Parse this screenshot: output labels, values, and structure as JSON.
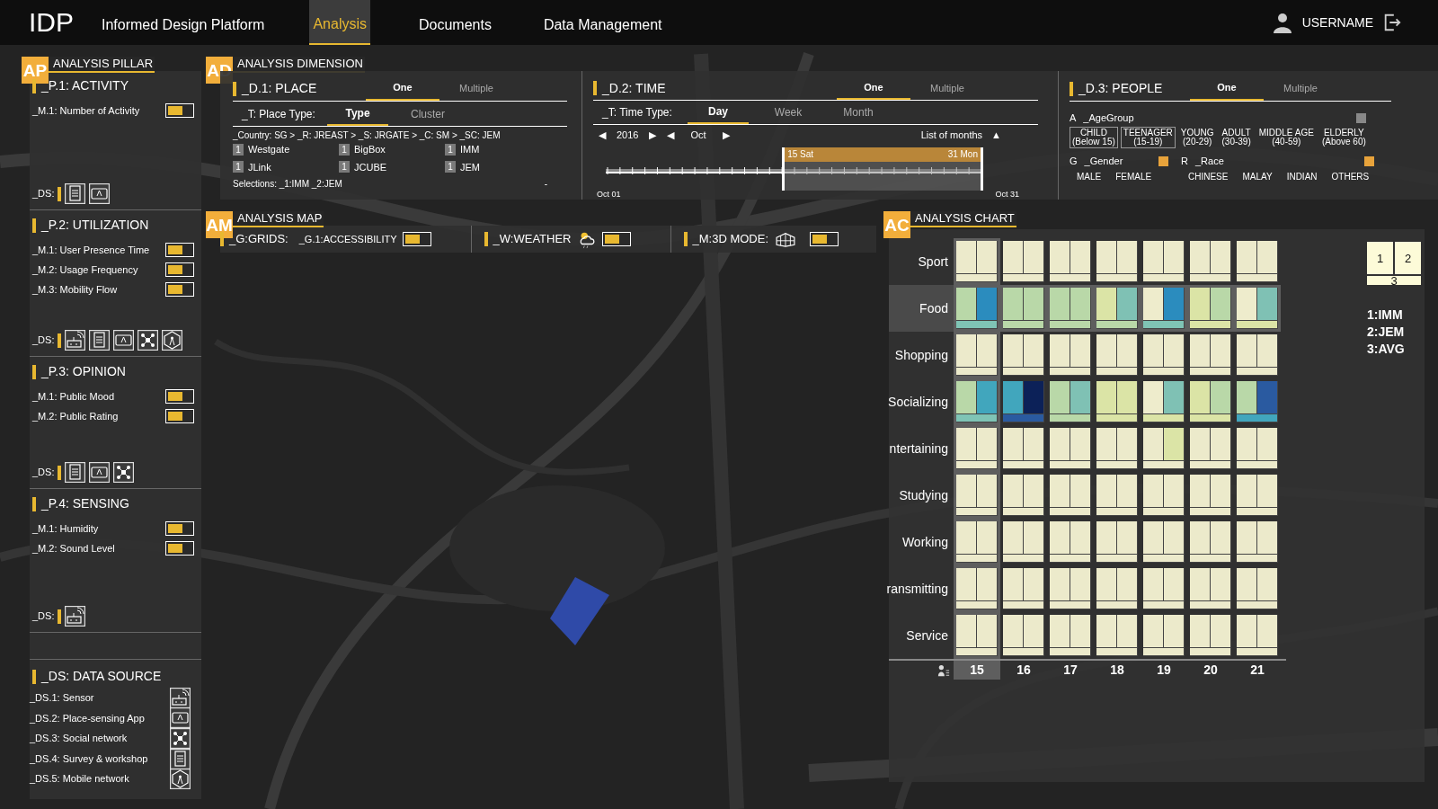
{
  "nav": {
    "logo": "IDP",
    "title": "Informed Design Platform",
    "user": "USERNAME",
    "tabs": [
      {
        "label": "Analysis",
        "selected": true
      },
      {
        "label": "Documents",
        "selected": false
      },
      {
        "label": "Data Management",
        "selected": false
      }
    ]
  },
  "pillar": {
    "badge": "AP",
    "title": "ANALYSIS PILLAR",
    "sections": [
      {
        "title": "_P.1: ACTIVITY",
        "metrics": [
          {
            "label": "_M.1: Number of Activity",
            "on": true
          }
        ],
        "ds_label": "_DS:",
        "sources": [
          {
            "kind": "survey"
          },
          {
            "kind": "app"
          }
        ]
      },
      {
        "title": "_P.2: UTILIZATION",
        "metrics": [
          {
            "label": "_M.1: User Presence Time",
            "on": true
          },
          {
            "label": "_M.2: Usage Frequency",
            "on": true
          },
          {
            "label": "_M.3: Mobility Flow",
            "on": true
          }
        ],
        "ds_label": "_DS:",
        "sources": [
          {
            "kind": "sensor"
          },
          {
            "kind": "survey"
          },
          {
            "kind": "app"
          },
          {
            "kind": "social"
          },
          {
            "kind": "mobile"
          }
        ]
      },
      {
        "title": "_P.3: OPINION",
        "metrics": [
          {
            "label": "_M.1: Public Mood",
            "on": true
          },
          {
            "label": "_M.2: Public Rating",
            "on": true
          }
        ],
        "ds_label": "_DS:",
        "sources": [
          {
            "kind": "survey"
          },
          {
            "kind": "app"
          },
          {
            "kind": "social"
          }
        ]
      },
      {
        "title": "_P.4: SENSING",
        "metrics": [
          {
            "label": "_M.1: Humidity",
            "on": true
          },
          {
            "label": "_M.2: Sound Level",
            "on": true
          }
        ],
        "ds_label": "_DS:",
        "sources": [
          {
            "kind": "sensor"
          }
        ]
      }
    ],
    "data_source": {
      "title": "_DS: DATA SOURCE",
      "items": [
        {
          "label": "_DS.1: Sensor",
          "kind": "sensor"
        },
        {
          "label": "_DS.2: Place-sensing App",
          "kind": "app"
        },
        {
          "label": "_DS.3: Social network",
          "kind": "social"
        },
        {
          "label": "_DS.4: Survey & workshop",
          "kind": "survey"
        },
        {
          "label": "_DS.5: Mobile network",
          "kind": "mobile"
        }
      ]
    }
  },
  "dimension": {
    "badge": "AD",
    "title": "ANALYSIS DIMENSION",
    "place": {
      "title": "_D.1: PLACE",
      "modes": [
        {
          "label": "One",
          "selected": true
        },
        {
          "label": "Multiple",
          "selected": false
        }
      ],
      "type_label": "_T: Place Type:",
      "types": [
        {
          "label": "Type",
          "selected": true
        },
        {
          "label": "Cluster",
          "selected": false
        }
      ],
      "breadcrumb": "_Country: SG > _R: JREAST > _S: JRGATE > _C: SM > _SC: JEM",
      "places": [
        {
          "count": "1",
          "name": "Westgate"
        },
        {
          "count": "1",
          "name": "BigBox"
        },
        {
          "count": "1",
          "name": "IMM"
        },
        {
          "count": "1",
          "name": "JLink"
        },
        {
          "count": "1",
          "name": "JCUBE"
        },
        {
          "count": "1",
          "name": "JEM"
        }
      ],
      "selections": "Selections: _1:IMM _2:JEM",
      "collapse": "-"
    },
    "time": {
      "title": "_D.2: TIME",
      "modes": [
        {
          "label": "One",
          "selected": true
        },
        {
          "label": "Multiple",
          "selected": false
        }
      ],
      "type_label": "_T: Time Type:",
      "types": [
        {
          "label": "Day",
          "selected": true
        },
        {
          "label": "Week",
          "selected": false
        },
        {
          "label": "Month",
          "selected": false
        }
      ],
      "year_prev": "◀",
      "year": "2016",
      "year_next": "▶",
      "month_prev": "◀",
      "month": "Oct",
      "month_next": "▶",
      "months_list": "List of months",
      "months_toggle": "▲",
      "start": "Oct 01",
      "end": "Oct 31",
      "range": {
        "from_label": "15 Sat",
        "to_label": "31 Mon",
        "handles": [
          {
            "level": 0.467
          },
          {
            "level": 1
          }
        ]
      }
    },
    "people": {
      "title": "_D.3: PEOPLE",
      "modes": [
        {
          "label": "One",
          "selected": true
        },
        {
          "label": "Multiple",
          "selected": false
        }
      ],
      "age": {
        "key": "A",
        "label": "_AgeGroup",
        "on": false,
        "groups": [
          {
            "name": "CHILD",
            "range": "(Below 15)",
            "selected": true
          },
          {
            "name": "TEENAGER",
            "range": "(15-19)",
            "selected": true
          },
          {
            "name": "YOUNG",
            "range": "(20-29)",
            "selected": false
          },
          {
            "name": "ADULT",
            "range": "(30-39)",
            "selected": false
          },
          {
            "name": "MIDDLE AGE",
            "range": "(40-59)",
            "selected": false
          },
          {
            "name": "ELDERLY",
            "range": "(Above 60)",
            "selected": false
          }
        ]
      },
      "gender": {
        "key": "G",
        "label": "_Gender",
        "on": true,
        "options": [
          "MALE",
          "FEMALE"
        ]
      },
      "race": {
        "key": "R",
        "label": "_Race",
        "on": true,
        "options": [
          "CHINESE",
          "MALAY",
          "INDIAN",
          "OTHERS"
        ]
      }
    }
  },
  "map": {
    "badge": "AM",
    "title": "ANALYSIS MAP",
    "grids_label": "_G:GRIDS:",
    "grids": [
      {
        "label": "_G.1:ACCESSIBILITY",
        "on": true
      }
    ],
    "weather": {
      "label": "_W:WEATHER",
      "on": true
    },
    "mode3d": {
      "label": "_M:3D MODE:",
      "on": true
    }
  },
  "chart": {
    "badge": "AC",
    "title": "ANALYSIS CHART",
    "columns": [
      {
        "label": "15",
        "selected": true
      },
      {
        "label": "16",
        "selected": false
      },
      {
        "label": "17",
        "selected": false
      },
      {
        "label": "18",
        "selected": false
      },
      {
        "label": "19",
        "selected": false
      },
      {
        "label": "20",
        "selected": false
      },
      {
        "label": "21",
        "selected": false
      }
    ],
    "rows": [
      {
        "label": "Sport",
        "selected": false,
        "cells": [
          {
            "segments": [
              {
                "color": "#eceacb"
              },
              {
                "color": "#eceacb"
              },
              {
                "color": "#eceacb"
              }
            ]
          },
          {
            "segments": [
              {
                "color": "#eceacb"
              },
              {
                "color": "#eceacb"
              },
              {
                "color": "#eceacb"
              }
            ]
          },
          {
            "segments": [
              {
                "color": "#eceacb"
              },
              {
                "color": "#eceacb"
              },
              {
                "color": "#eceacb"
              }
            ]
          },
          {
            "segments": [
              {
                "color": "#eceacb"
              },
              {
                "color": "#eceacb"
              },
              {
                "color": "#eceacb"
              }
            ]
          },
          {
            "segments": [
              {
                "color": "#eceacb"
              },
              {
                "color": "#eceacb"
              },
              {
                "color": "#eceacb"
              }
            ]
          },
          {
            "segments": [
              {
                "color": "#eceacb"
              },
              {
                "color": "#eceacb"
              },
              {
                "color": "#eceacb"
              }
            ]
          },
          {
            "segments": [
              {
                "color": "#eceacb"
              },
              {
                "color": "#eceacb"
              },
              {
                "color": "#eceacb"
              }
            ]
          }
        ]
      },
      {
        "label": "Food",
        "selected": true,
        "cells": [
          {
            "segments": [
              {
                "color": "#b9d8a8"
              },
              {
                "color": "#2b8cbe"
              },
              {
                "color": "#7fc4b5"
              }
            ]
          },
          {
            "segments": [
              {
                "color": "#b9d8a8"
              },
              {
                "color": "#b9d8a8"
              },
              {
                "color": "#b9d8a8"
              }
            ]
          },
          {
            "segments": [
              {
                "color": "#b9d8a8"
              },
              {
                "color": "#b9d8a8"
              },
              {
                "color": "#b9d8a8"
              }
            ]
          },
          {
            "segments": [
              {
                "color": "#dbe4a6"
              },
              {
                "color": "#7fc1b4"
              },
              {
                "color": "#b9d8a8"
              }
            ]
          },
          {
            "segments": [
              {
                "color": "#eeeccc"
              },
              {
                "color": "#2b8cbe"
              },
              {
                "color": "#7fc4b5"
              }
            ]
          },
          {
            "segments": [
              {
                "color": "#dbe4a6"
              },
              {
                "color": "#b9d8a8"
              },
              {
                "color": "#dbe4a6"
              }
            ]
          },
          {
            "segments": [
              {
                "color": "#eeeccc"
              },
              {
                "color": "#7fc1b4"
              },
              {
                "color": "#dbe4a6"
              }
            ]
          }
        ]
      },
      {
        "label": "Shopping",
        "selected": false,
        "cells": [
          {
            "segments": [
              {
                "color": "#eceacb"
              },
              {
                "color": "#eceacb"
              },
              {
                "color": "#eceacb"
              }
            ]
          },
          {
            "segments": [
              {
                "color": "#eceacb"
              },
              {
                "color": "#eceacb"
              },
              {
                "color": "#eceacb"
              }
            ]
          },
          {
            "segments": [
              {
                "color": "#eceacb"
              },
              {
                "color": "#eceacb"
              },
              {
                "color": "#eceacb"
              }
            ]
          },
          {
            "segments": [
              {
                "color": "#eceacb"
              },
              {
                "color": "#eceacb"
              },
              {
                "color": "#eceacb"
              }
            ]
          },
          {
            "segments": [
              {
                "color": "#eceacb"
              },
              {
                "color": "#eceacb"
              },
              {
                "color": "#eceacb"
              }
            ]
          },
          {
            "segments": [
              {
                "color": "#eceacb"
              },
              {
                "color": "#eceacb"
              },
              {
                "color": "#eceacb"
              }
            ]
          },
          {
            "segments": [
              {
                "color": "#eceacb"
              },
              {
                "color": "#eceacb"
              },
              {
                "color": "#eceacb"
              }
            ]
          }
        ]
      },
      {
        "label": "Socializing",
        "selected": false,
        "cells": [
          {
            "segments": [
              {
                "color": "#b9d8a8"
              },
              {
                "color": "#41a6bd"
              },
              {
                "color": "#7fc4b5"
              }
            ]
          },
          {
            "segments": [
              {
                "color": "#41a6bd"
              },
              {
                "color": "#0c2158"
              },
              {
                "color": "#2a5aa0"
              }
            ]
          },
          {
            "segments": [
              {
                "color": "#b9d8a8"
              },
              {
                "color": "#7fc1b4"
              },
              {
                "color": "#b9d8a8"
              }
            ]
          },
          {
            "segments": [
              {
                "color": "#dbe4a6"
              },
              {
                "color": "#dbe4a6"
              },
              {
                "color": "#dbe4a6"
              }
            ]
          },
          {
            "segments": [
              {
                "color": "#eeeccc"
              },
              {
                "color": "#7fc1b4"
              },
              {
                "color": "#dbe4a6"
              }
            ]
          },
          {
            "segments": [
              {
                "color": "#dbe4a6"
              },
              {
                "color": "#b9d8a8"
              },
              {
                "color": "#dbe4a6"
              }
            ]
          },
          {
            "segments": [
              {
                "color": "#b9d8a8"
              },
              {
                "color": "#2a5aa0"
              },
              {
                "color": "#41a6bd"
              }
            ]
          }
        ]
      },
      {
        "label": "ntertaining",
        "selected": false,
        "cells": [
          {
            "segments": [
              {
                "color": "#eceacb"
              },
              {
                "color": "#eceacb"
              },
              {
                "color": "#eceacb"
              }
            ]
          },
          {
            "segments": [
              {
                "color": "#eceacb"
              },
              {
                "color": "#eceacb"
              },
              {
                "color": "#eceacb"
              }
            ]
          },
          {
            "segments": [
              {
                "color": "#eceacb"
              },
              {
                "color": "#eceacb"
              },
              {
                "color": "#eceacb"
              }
            ]
          },
          {
            "segments": [
              {
                "color": "#eceacb"
              },
              {
                "color": "#eceacb"
              },
              {
                "color": "#eceacb"
              }
            ]
          },
          {
            "segments": [
              {
                "color": "#eceacb"
              },
              {
                "color": "#dbe4a6"
              },
              {
                "color": "#eceacb"
              }
            ]
          },
          {
            "segments": [
              {
                "color": "#eceacb"
              },
              {
                "color": "#eceacb"
              },
              {
                "color": "#eceacb"
              }
            ]
          },
          {
            "segments": [
              {
                "color": "#eceacb"
              },
              {
                "color": "#eceacb"
              },
              {
                "color": "#eceacb"
              }
            ]
          }
        ]
      },
      {
        "label": "Studying",
        "selected": false,
        "cells": [
          {
            "segments": [
              {
                "color": "#eceacb"
              },
              {
                "color": "#eceacb"
              },
              {
                "color": "#eceacb"
              }
            ]
          },
          {
            "segments": [
              {
                "color": "#eceacb"
              },
              {
                "color": "#eceacb"
              },
              {
                "color": "#eceacb"
              }
            ]
          },
          {
            "segments": [
              {
                "color": "#eceacb"
              },
              {
                "color": "#eceacb"
              },
              {
                "color": "#eceacb"
              }
            ]
          },
          {
            "segments": [
              {
                "color": "#eceacb"
              },
              {
                "color": "#eceacb"
              },
              {
                "color": "#eceacb"
              }
            ]
          },
          {
            "segments": [
              {
                "color": "#eceacb"
              },
              {
                "color": "#eceacb"
              },
              {
                "color": "#eceacb"
              }
            ]
          },
          {
            "segments": [
              {
                "color": "#eceacb"
              },
              {
                "color": "#eceacb"
              },
              {
                "color": "#eceacb"
              }
            ]
          },
          {
            "segments": [
              {
                "color": "#eceacb"
              },
              {
                "color": "#eceacb"
              },
              {
                "color": "#eceacb"
              }
            ]
          }
        ]
      },
      {
        "label": "Working",
        "selected": false,
        "cells": [
          {
            "segments": [
              {
                "color": "#eceacb"
              },
              {
                "color": "#eceacb"
              },
              {
                "color": "#eceacb"
              }
            ]
          },
          {
            "segments": [
              {
                "color": "#eceacb"
              },
              {
                "color": "#eceacb"
              },
              {
                "color": "#eceacb"
              }
            ]
          },
          {
            "segments": [
              {
                "color": "#eceacb"
              },
              {
                "color": "#eceacb"
              },
              {
                "color": "#eceacb"
              }
            ]
          },
          {
            "segments": [
              {
                "color": "#eceacb"
              },
              {
                "color": "#eceacb"
              },
              {
                "color": "#eceacb"
              }
            ]
          },
          {
            "segments": [
              {
                "color": "#eceacb"
              },
              {
                "color": "#eceacb"
              },
              {
                "color": "#eceacb"
              }
            ]
          },
          {
            "segments": [
              {
                "color": "#eceacb"
              },
              {
                "color": "#eceacb"
              },
              {
                "color": "#eceacb"
              }
            ]
          },
          {
            "segments": [
              {
                "color": "#eceacb"
              },
              {
                "color": "#eceacb"
              },
              {
                "color": "#eceacb"
              }
            ]
          }
        ]
      },
      {
        "label": "ransmitting",
        "selected": false,
        "cells": [
          {
            "segments": [
              {
                "color": "#eceacb"
              },
              {
                "color": "#eceacb"
              },
              {
                "color": "#eceacb"
              }
            ]
          },
          {
            "segments": [
              {
                "color": "#eceacb"
              },
              {
                "color": "#eceacb"
              },
              {
                "color": "#eceacb"
              }
            ]
          },
          {
            "segments": [
              {
                "color": "#eceacb"
              },
              {
                "color": "#eceacb"
              },
              {
                "color": "#eceacb"
              }
            ]
          },
          {
            "segments": [
              {
                "color": "#eceacb"
              },
              {
                "color": "#eceacb"
              },
              {
                "color": "#eceacb"
              }
            ]
          },
          {
            "segments": [
              {
                "color": "#eceacb"
              },
              {
                "color": "#eceacb"
              },
              {
                "color": "#eceacb"
              }
            ]
          },
          {
            "segments": [
              {
                "color": "#eceacb"
              },
              {
                "color": "#eceacb"
              },
              {
                "color": "#eceacb"
              }
            ]
          },
          {
            "segments": [
              {
                "color": "#eceacb"
              },
              {
                "color": "#eceacb"
              },
              {
                "color": "#eceacb"
              }
            ]
          }
        ]
      },
      {
        "label": "Service",
        "selected": false,
        "cells": [
          {
            "segments": [
              {
                "color": "#eceacb"
              },
              {
                "color": "#eceacb"
              },
              {
                "color": "#eceacb"
              }
            ]
          },
          {
            "segments": [
              {
                "color": "#eceacb"
              },
              {
                "color": "#eceacb"
              },
              {
                "color": "#eceacb"
              }
            ]
          },
          {
            "segments": [
              {
                "color": "#eceacb"
              },
              {
                "color": "#eceacb"
              },
              {
                "color": "#eceacb"
              }
            ]
          },
          {
            "segments": [
              {
                "color": "#eceacb"
              },
              {
                "color": "#eceacb"
              },
              {
                "color": "#eceacb"
              }
            ]
          },
          {
            "segments": [
              {
                "color": "#eceacb"
              },
              {
                "color": "#eceacb"
              },
              {
                "color": "#eceacb"
              }
            ]
          },
          {
            "segments": [
              {
                "color": "#eceacb"
              },
              {
                "color": "#eceacb"
              },
              {
                "color": "#eceacb"
              }
            ]
          },
          {
            "segments": [
              {
                "color": "#eceacb"
              },
              {
                "color": "#eceacb"
              },
              {
                "color": "#eceacb"
              }
            ]
          }
        ]
      }
    ],
    "legend": {
      "parts": [
        "1",
        "2",
        "3"
      ],
      "entries": [
        "1:IMM",
        "2:JEM",
        "3:AVG"
      ]
    }
  }
}
